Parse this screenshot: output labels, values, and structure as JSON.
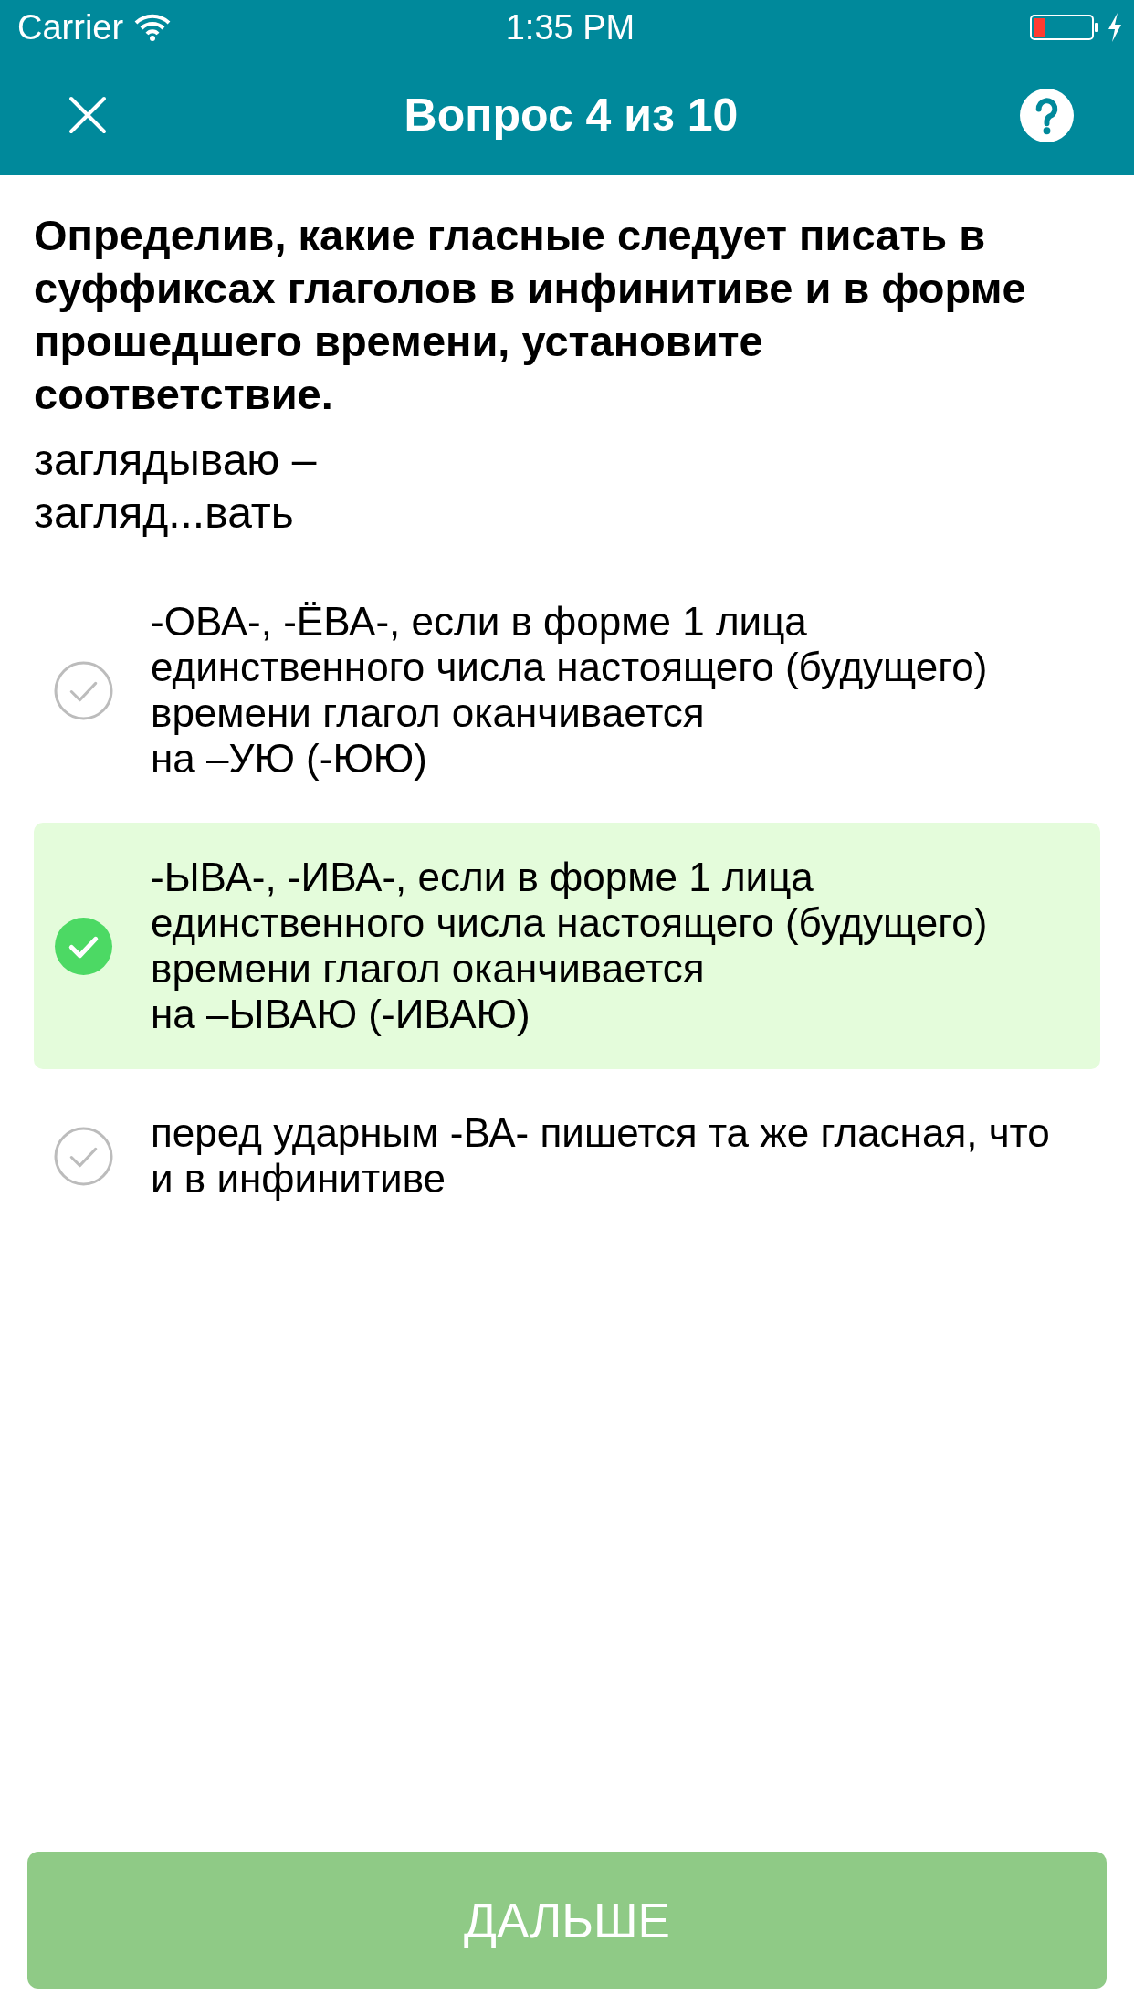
{
  "status_bar": {
    "carrier": "Carrier",
    "time": "1:35 PM"
  },
  "nav": {
    "title": "Вопрос 4 из 10"
  },
  "question": {
    "prompt": "Определив, какие гласные следует писать в суффиксах глаголов в инфинитиве и в форме прошедшего времени, установите соответствие.",
    "example": "заглядываю –\nзагляд...вать"
  },
  "options": [
    {
      "text": "-ОВА-, -ЁВА-, если в форме 1 лица\nединственного числа настоящего (будущего)\nвремени глагол оканчивается\nна –УЮ (-ЮЮ)",
      "selected": false
    },
    {
      "text": "-ЫВА-, -ИВА-, если в форме 1 лица\nединственного числа настоящего (будущего)\nвремени глагол оканчивается\nна –ЫВАЮ (-ИВАЮ)",
      "selected": true
    },
    {
      "text": "перед ударным -ВА- пишется та же гласная, что и в инфинитиве",
      "selected": false
    }
  ],
  "next_button": {
    "label": "ДАЛЬШЕ"
  }
}
